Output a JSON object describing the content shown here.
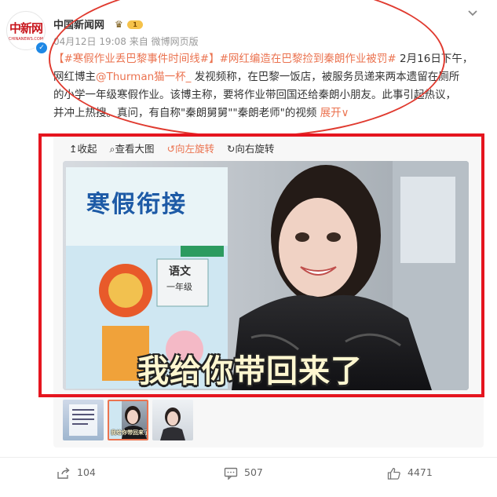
{
  "header": {
    "avatar_logo": "中新网",
    "avatar_logo_sub": "CHINANEWS.COM",
    "username": "中国新闻网",
    "vip_level": "1",
    "meta": "04月12日 19:08  来自 微博网页版"
  },
  "post": {
    "hashtag1": "【#寒假作业丢巴黎事件时间线#】",
    "hashtag2": "#网红编造在巴黎捡到秦朗作业被罚#",
    "text1": "2月16日下午，",
    "text2": "网红博主",
    "mention": "@Thurman猫一杯_",
    "text3": "发视频称，在巴黎一饭店，被服务员递来两本遗留在厕所",
    "line3": "的小学一年级寒假作业。该博主称，要将作业带回国还给秦朗小朋友。此事引起热议，",
    "line4": "并冲上热搜。真问，有自称\"秦朗舅舅\"\"秦朗老师\"的视频",
    "expand": "展开∨"
  },
  "toolbar": {
    "collapse": "↥收起",
    "view_large": "⌕查看大图",
    "rotate_left": "↺向左旋转",
    "rotate_right": "↻向右旋转"
  },
  "image": {
    "book_title": "寒假衔接",
    "book_subject": "语文",
    "book_grade": "一年级",
    "subtitle": "我给你带回来了"
  },
  "thumbnails": {
    "mini_caption": "我给你带回来了"
  },
  "footer": {
    "shares": "104",
    "comments": "507",
    "likes": "4471"
  },
  "colors": {
    "accent": "#eb7350",
    "annotation_red": "#e5151f"
  }
}
